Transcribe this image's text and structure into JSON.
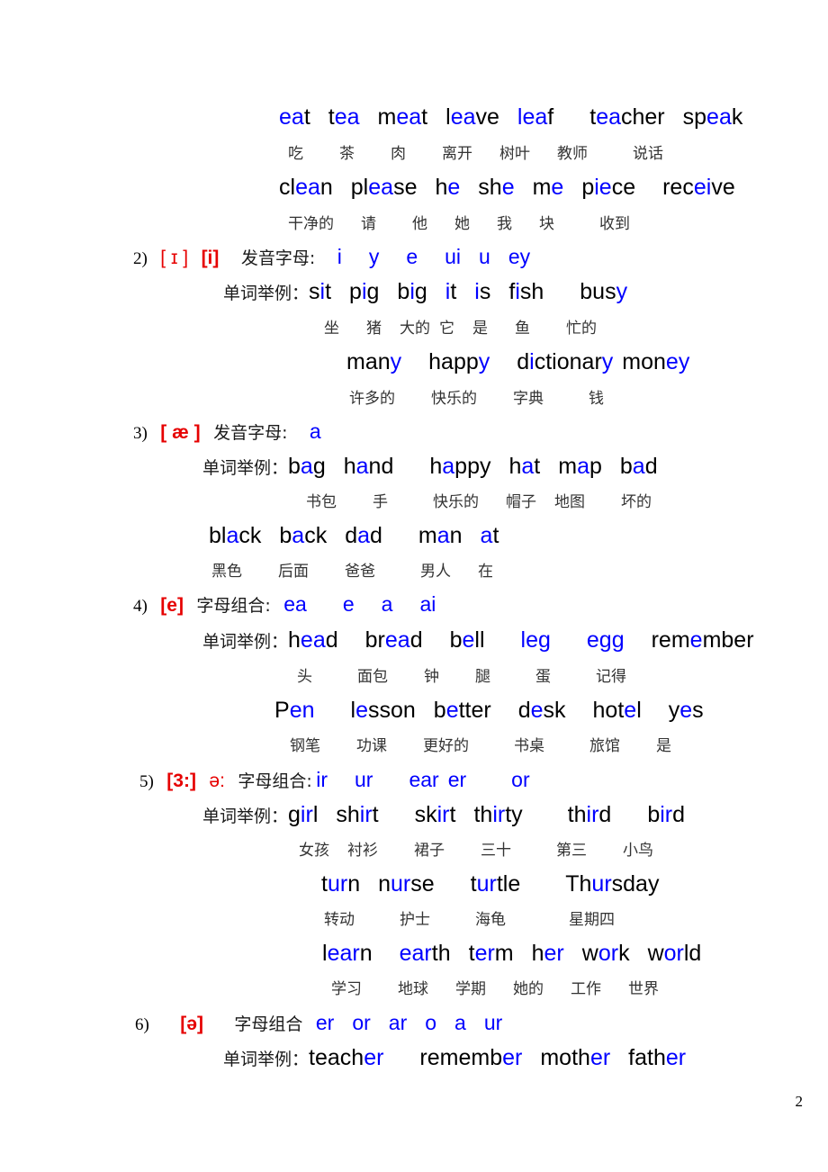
{
  "page": {
    "number": "2",
    "label_word_examples": "单词举例：",
    "label_pronounce_letters": "发音字母:",
    "label_letter_combo": "字母组合:",
    "label_letter_combo_nocolon": "字母组合"
  },
  "section1": {
    "rows": [
      {
        "words": [
          {
            "pre": "",
            "hl": "ea",
            "post": "t",
            "cn": "吃"
          },
          {
            "pre": "t",
            "hl": "ea",
            "post": "",
            "cn": "茶"
          },
          {
            "pre": "m",
            "hl": "ea",
            "post": "t",
            "cn": "肉"
          },
          {
            "pre": "l",
            "hl": "ea",
            "post": "ve",
            "cn": "离开"
          },
          {
            "pre": "",
            "hl": "lea",
            "post": "f",
            "cn": "树叶"
          },
          {
            "pre": "t",
            "hl": "ea",
            "post": "cher",
            "cn": "教师"
          },
          {
            "pre": "sp",
            "hl": "ea",
            "post": "k",
            "cn": "说话"
          }
        ]
      },
      {
        "words": [
          {
            "pre": "cl",
            "hl": "ea",
            "post": "n",
            "cn": "干净的"
          },
          {
            "pre": "pl",
            "hl": "ea",
            "post": "se",
            "cn": "请"
          },
          {
            "pre": "h",
            "hl": "e",
            "post": "",
            "cn": "他"
          },
          {
            "pre": "sh",
            "hl": "e",
            "post": "",
            "cn": "她"
          },
          {
            "pre": "m",
            "hl": "e",
            "post": "",
            "cn": "我"
          },
          {
            "pre": "p",
            "hl": "ie",
            "post": "ce",
            "cn": "块"
          },
          {
            "pre": "rec",
            "hl": "ei",
            "post": "ve",
            "cn": "收到"
          }
        ]
      }
    ]
  },
  "section2": {
    "index": "2)",
    "phonetics": [
      "[ ɪ ]",
      "[i]"
    ],
    "letters": [
      "i",
      "y",
      "e",
      "ui",
      "u",
      "ey"
    ],
    "row1": [
      {
        "pre": "s",
        "hl": "i",
        "post": "t",
        "cn": "坐"
      },
      {
        "pre": "p",
        "hl": "i",
        "post": "g",
        "cn": "猪"
      },
      {
        "pre": "b",
        "hl": "i",
        "post": "g",
        "cn": "大的"
      },
      {
        "pre": "",
        "hl": "i",
        "post": "t",
        "cn": "它"
      },
      {
        "pre": "",
        "hl": "i",
        "post": "s",
        "cn": "是"
      },
      {
        "pre": "f",
        "hl": "i",
        "post": "sh",
        "cn": "鱼"
      },
      {
        "pre": "bus",
        "hl": "y",
        "post": "",
        "cn": "忙的"
      }
    ],
    "row2": [
      {
        "pre": "man",
        "hl": "y",
        "post": "",
        "cn": "许多的"
      },
      {
        "pre": "happ",
        "hl": "y",
        "post": "",
        "cn": "快乐的"
      },
      {
        "pre": "d",
        "hl": "i",
        "post": "ctionar",
        "hl2": "y",
        "cn": "字典"
      },
      {
        "pre": "mon",
        "hl": "ey",
        "post": "",
        "cn": "钱"
      }
    ]
  },
  "section3": {
    "index": "3)",
    "phonetic": "[ æ ]",
    "letters": [
      "a"
    ],
    "row1": [
      {
        "pre": "b",
        "hl": "a",
        "post": "g",
        "cn": "书包"
      },
      {
        "pre": "h",
        "hl": "a",
        "post": "nd",
        "cn": "手"
      },
      {
        "pre": "h",
        "hl": "a",
        "post": "ppy",
        "cn": "快乐的"
      },
      {
        "pre": "h",
        "hl": "a",
        "post": "t",
        "cn": "帽子"
      },
      {
        "pre": "m",
        "hl": "a",
        "post": "p",
        "cn": "地图"
      },
      {
        "pre": "b",
        "hl": "a",
        "post": "d",
        "cn": "坏的"
      }
    ],
    "row2": [
      {
        "pre": "bl",
        "hl": "a",
        "post": "ck",
        "cn": "黑色"
      },
      {
        "pre": "b",
        "hl": "a",
        "post": "ck",
        "cn": "后面"
      },
      {
        "pre": "d",
        "hl": "a",
        "post": "d",
        "cn": "爸爸"
      },
      {
        "pre": "m",
        "hl": "a",
        "post": "n",
        "cn": "男人"
      },
      {
        "pre": "",
        "hl": "a",
        "post": "t",
        "cn": "在"
      }
    ]
  },
  "section4": {
    "index": "4)",
    "phonetic": "[e]",
    "letters": [
      "ea",
      "e",
      "a",
      "ai"
    ],
    "row1": [
      {
        "pre": "h",
        "hl": "ea",
        "post": "d",
        "cn": "头"
      },
      {
        "pre": "br",
        "hl": "ea",
        "post": "d",
        "cn": "面包"
      },
      {
        "pre": "b",
        "hl": "e",
        "post": "ll",
        "cn": "钟"
      },
      {
        "pre": "",
        "hl": "leg",
        "post": "",
        "cn": "腿"
      },
      {
        "pre": "",
        "hl": "egg",
        "post": "",
        "cn": "蛋"
      },
      {
        "pre": "rem",
        "hl": "e",
        "post": "mber",
        "cn": "记得"
      }
    ],
    "row2": [
      {
        "pre": "P",
        "hl": "en",
        "post": "",
        "cn": "钢笔"
      },
      {
        "pre": "l",
        "hl": "e",
        "post": "sson",
        "cn": "功课"
      },
      {
        "pre": "b",
        "hl": "e",
        "post": "tter",
        "cn": "更好的"
      },
      {
        "pre": "d",
        "hl": "e",
        "post": "sk",
        "cn": "书桌"
      },
      {
        "pre": "hot",
        "hl": "e",
        "post": "l",
        "cn": "旅馆"
      },
      {
        "pre": "y",
        "hl": "e",
        "post": "s",
        "cn": "是"
      }
    ]
  },
  "section5": {
    "index": "5)",
    "phonetic": "[3:]",
    "phonetic2": "ə:",
    "letters": [
      "ir",
      "ur",
      "ear",
      "er",
      "or"
    ],
    "row1": [
      {
        "pre": "g",
        "hl": "ir",
        "post": "l",
        "cn": "女孩"
      },
      {
        "pre": "sh",
        "hl": "ir",
        "post": "t",
        "cn": "衬衫"
      },
      {
        "pre": "sk",
        "hl": "ir",
        "post": "t",
        "cn": "裙子"
      },
      {
        "pre": "th",
        "hl": "ir",
        "post": "ty",
        "cn": "三十"
      },
      {
        "pre": "th",
        "hl": "ir",
        "post": "d",
        "cn": "第三"
      },
      {
        "pre": "b",
        "hl": "ir",
        "post": "d",
        "cn": "小鸟"
      }
    ],
    "row2": [
      {
        "pre": "t",
        "hl": "ur",
        "post": "n",
        "cn": "转动"
      },
      {
        "pre": "n",
        "hl": "ur",
        "post": "se",
        "cn": "护士"
      },
      {
        "pre": "t",
        "hl": "ur",
        "post": "tle",
        "cn": "海龟"
      },
      {
        "pre": "Th",
        "hl": "ur",
        "post": "sday",
        "cn": "星期四"
      }
    ],
    "row3": [
      {
        "pre": "l",
        "hl": "ear",
        "post": "n",
        "cn": "学习"
      },
      {
        "pre": "",
        "hl": "ear",
        "post": "th",
        "cn": "地球"
      },
      {
        "pre": "t",
        "hl": "er",
        "post": "m",
        "cn": "学期"
      },
      {
        "pre": "h",
        "hl": "er",
        "post": "",
        "cn": "她的"
      },
      {
        "pre": "w",
        "hl": "or",
        "post": "k",
        "cn": "工作"
      },
      {
        "pre": "w",
        "hl": "or",
        "post": "ld",
        "cn": "世界"
      }
    ]
  },
  "section6": {
    "index": "6)",
    "phonetic": "[ə]",
    "letters": [
      "er",
      "or",
      "ar",
      "o",
      "a",
      "ur"
    ],
    "row1": [
      {
        "pre": "teach",
        "hl": "er",
        "post": ""
      },
      {
        "pre": "rememb",
        "hl": "er",
        "post": ""
      },
      {
        "pre": "moth",
        "hl": "er",
        "post": ""
      },
      {
        "pre": "fath",
        "hl": "er",
        "post": ""
      }
    ]
  }
}
